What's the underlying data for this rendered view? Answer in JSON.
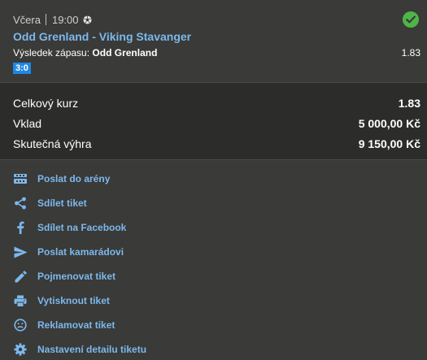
{
  "bet": {
    "day": "Včera",
    "time": "19:00",
    "sport_icon": "soccer-ball-icon",
    "status_icon": "check-circle-icon",
    "match": "Odd Grenland - Viking Stavanger",
    "market_label": "Výsledek zápasu:",
    "selection": "Odd Grenland",
    "odd": "1.83",
    "score": "3:0"
  },
  "summary": {
    "total_odds_label": "Celkový kurz",
    "total_odds_value": "1.83",
    "stake_label": "Vklad",
    "stake_value": "5 000,00 Kč",
    "win_label": "Skutečná výhra",
    "win_value": "9 150,00 Kč"
  },
  "actions": [
    {
      "label": "Poslat do arény",
      "icon": "arena-icon"
    },
    {
      "label": "Sdílet tiket",
      "icon": "share-icon"
    },
    {
      "label": "Sdílet na Facebook",
      "icon": "facebook-icon"
    },
    {
      "label": "Poslat kamarádovi",
      "icon": "send-icon"
    },
    {
      "label": "Pojmenovat tiket",
      "icon": "pencil-icon"
    },
    {
      "label": "Vytisknout tiket",
      "icon": "printer-icon"
    },
    {
      "label": "Reklamovat tiket",
      "icon": "sad-face-icon"
    },
    {
      "label": "Nastavení detailu tiketu",
      "icon": "gear-icon"
    }
  ],
  "colors": {
    "link": "#7cb8ec",
    "success": "#4fb548",
    "score_badge": "#1e88e5",
    "panel": "#3a3a38",
    "summary_panel": "#2c2c2b"
  }
}
